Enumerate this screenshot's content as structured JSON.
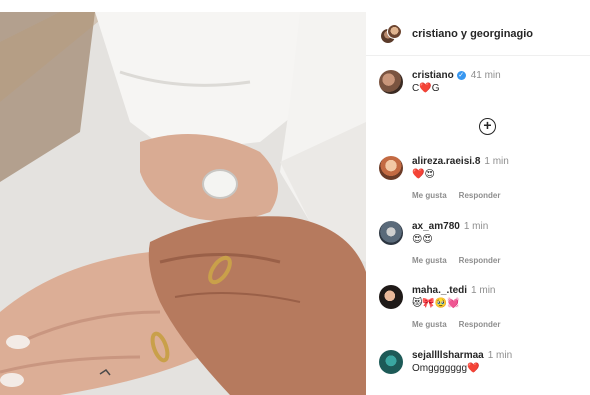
{
  "header": {
    "title": "cristiano y georginagio"
  },
  "caption": {
    "username": "cristiano",
    "verified_icon": "verified-badge-icon",
    "time": "41 min",
    "text_before": "C",
    "heart": "❤️",
    "text_after": "G"
  },
  "add_icon": "+",
  "actions": {
    "like": "Me gusta",
    "reply": "Responder"
  },
  "comments": [
    {
      "username": "alireza.raeisi.8",
      "time": "1 min",
      "text": "❤️😍",
      "show_actions": true
    },
    {
      "username": "ax_am780",
      "time": "1 min",
      "text": "😍😍",
      "show_actions": true
    },
    {
      "username": "maha._.tedi",
      "time": "1 min",
      "text": "😻🎀🥹💓",
      "show_actions": true
    },
    {
      "username": "sejallllsharmaa",
      "time": "1 min",
      "text": "Omggggggg❤️",
      "show_actions": false
    }
  ],
  "colors": {
    "accent_heart": "#ed2b55",
    "verified": "#3897f0",
    "secondary_text": "#8e8e8e"
  }
}
